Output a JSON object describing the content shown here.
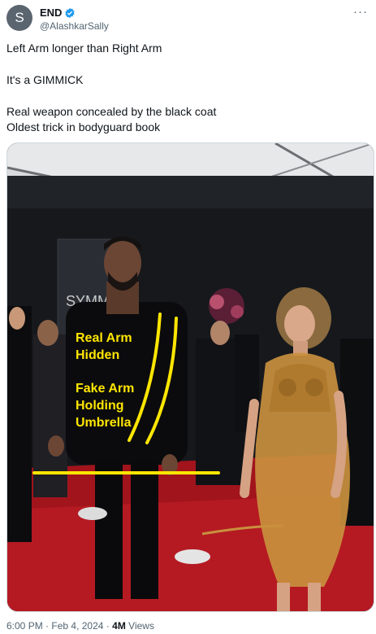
{
  "author": {
    "avatar_letter": "S",
    "display_name": "END",
    "handle": "@AlashkarSally",
    "verified_color": "#1d9bf0"
  },
  "tweet": {
    "lines": [
      "Left Arm longer than Right Arm",
      "It's a GIMMICK",
      "Real weapon concealed by the black coat",
      "Oldest trick in bodyguard book"
    ]
  },
  "media": {
    "backdrop_text": "SYMM",
    "annotation_1": [
      "Real Arm",
      "Hidden"
    ],
    "annotation_2": [
      "Fake Arm",
      "Holding",
      "Umbrella"
    ],
    "annotation_color": "#ffe600"
  },
  "meta": {
    "time": "6:00 PM",
    "date": "Feb 4, 2024",
    "views_count": "4M",
    "views_label": "Views"
  }
}
